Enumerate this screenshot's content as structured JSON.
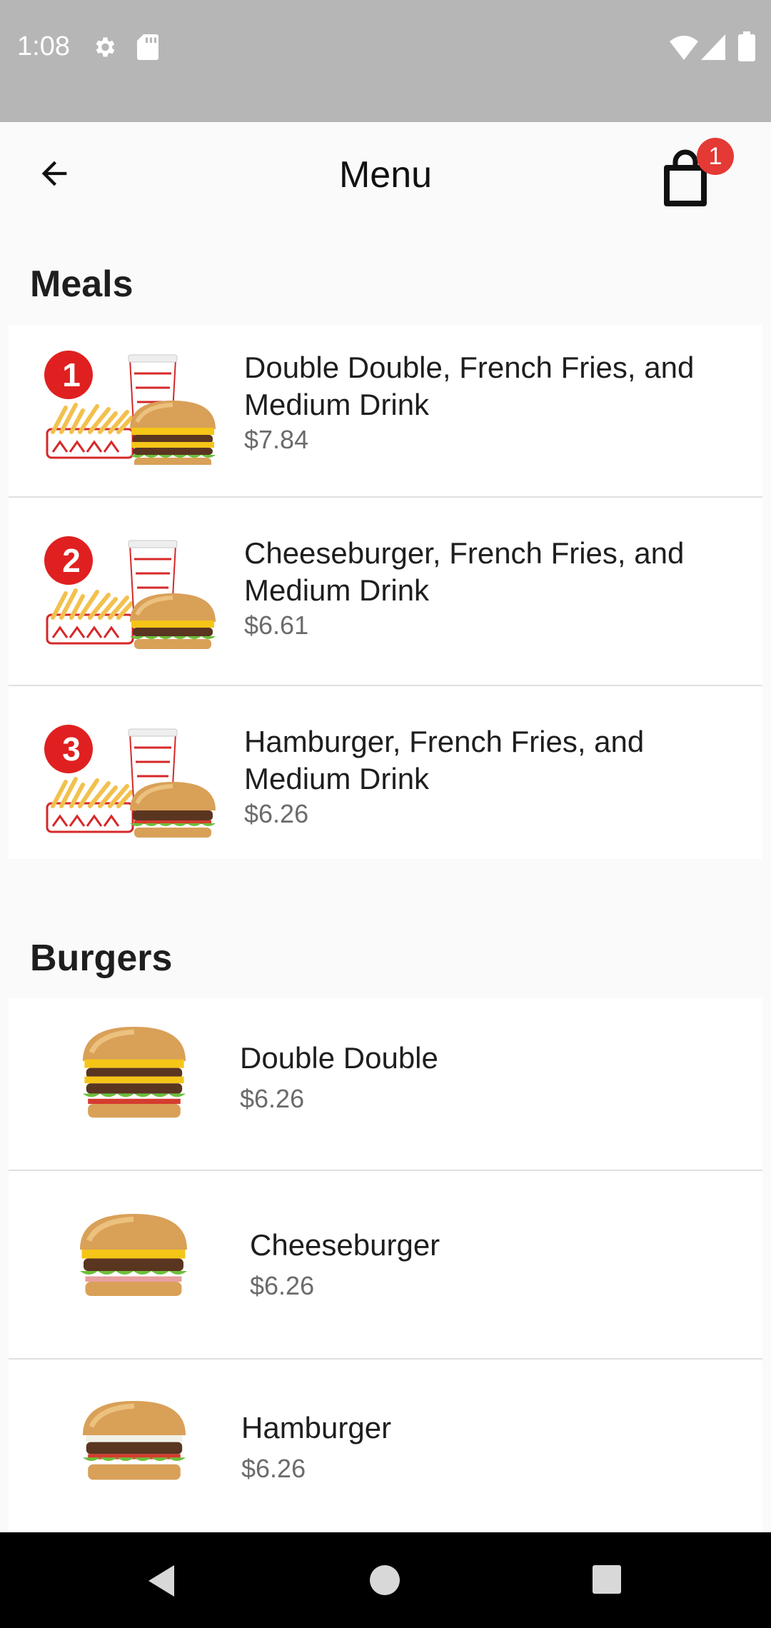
{
  "status_bar": {
    "time": "1:08"
  },
  "app_bar": {
    "title": "Menu",
    "cart_count": "1"
  },
  "sections": [
    {
      "title": "Meals",
      "items": [
        {
          "badge": "1",
          "name": "Double Double, French Fries, and Medium Drink",
          "price": "$7.84"
        },
        {
          "badge": "2",
          "name": "Cheeseburger, French Fries, and Medium Drink",
          "price": "$6.61"
        },
        {
          "badge": "3",
          "name": "Hamburger, French Fries, and Medium Drink",
          "price": "$6.26"
        }
      ]
    },
    {
      "title": "Burgers",
      "items": [
        {
          "name": "Double Double",
          "price": "$6.26"
        },
        {
          "name": "Cheeseburger",
          "price": "$6.26"
        },
        {
          "name": "Hamburger",
          "price": "$6.26"
        }
      ]
    }
  ],
  "colors": {
    "accent_red": "#e53935",
    "status_bar": "#b6b6b6",
    "nav_bar": "#000000"
  }
}
